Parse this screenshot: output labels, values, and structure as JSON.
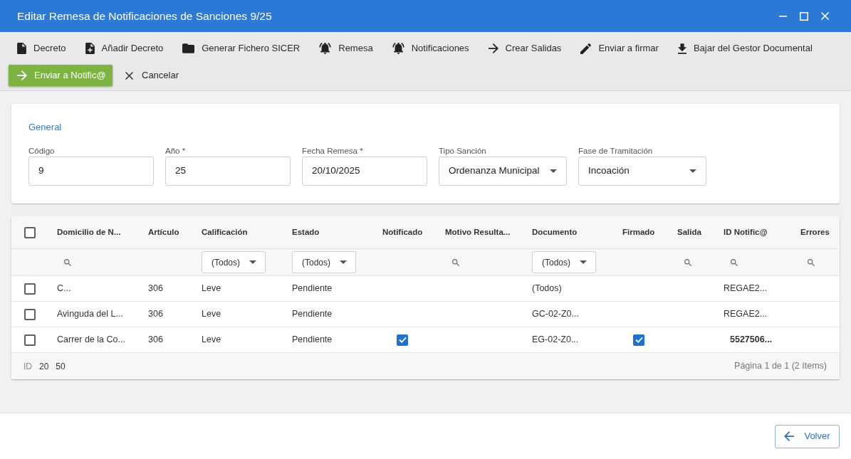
{
  "window": {
    "title": "Editar Remesa de Notificaciones de Sanciones 9/25"
  },
  "toolbar": {
    "items": [
      {
        "label": "Decreto"
      },
      {
        "label": "Añadir Decreto"
      },
      {
        "label": "Generar Fichero SICER"
      },
      {
        "label": "Remesa"
      },
      {
        "label": "Notificaciones"
      },
      {
        "label": "Crear Salidas"
      },
      {
        "label": "Enviar a firmar"
      },
      {
        "label": "Bajar del Gestor Documental"
      }
    ],
    "primary_button": {
      "label": "Enviar a Notific@"
    },
    "cancel_button": {
      "label": "Cancelar"
    }
  },
  "general": {
    "title": "General",
    "fields": [
      {
        "label": "Código",
        "value": "9",
        "kind": "text"
      },
      {
        "label": "Año *",
        "value": "25",
        "kind": "text"
      },
      {
        "label": "Fecha Remesa *",
        "value": "20/10/2025",
        "kind": "text"
      },
      {
        "label": "Tipo Sanción",
        "value": "Ordenanza Municipal",
        "kind": "select"
      },
      {
        "label": "Fase de Tramitación",
        "value": "Incoación",
        "kind": "select"
      }
    ]
  },
  "table": {
    "select_all": {
      "checked": false
    },
    "columns": [
      {
        "label": "Domicilio de N...",
        "filter": {
          "kind": "search"
        }
      },
      {
        "label": "Artículo",
        "filter": {
          "kind": "none"
        }
      },
      {
        "label": "Calificación",
        "filter": {
          "kind": "select",
          "value": "(Todos)"
        }
      },
      {
        "label": "Estado",
        "filter": {
          "kind": "select",
          "value": "(Todos)"
        }
      },
      {
        "label": "Notificado",
        "filter": {
          "kind": "none"
        }
      },
      {
        "label": "Motivo Resulta...",
        "filter": {
          "kind": "search"
        }
      },
      {
        "label": "Documento",
        "filter": {
          "kind": "select",
          "value": "(Todos)"
        }
      },
      {
        "label": "Firmado",
        "filter": {
          "kind": "none"
        }
      },
      {
        "label": "Salida",
        "filter": {
          "kind": "search"
        }
      },
      {
        "label": "ID Notific@",
        "filter": {
          "kind": "search"
        }
      },
      {
        "label": "Errores",
        "filter": {
          "kind": "search"
        }
      }
    ],
    "rows": [
      {
        "selected": false,
        "domicilio": "C...",
        "articulo": "306",
        "calificacion": "Leve",
        "estado": "Pendiente",
        "notificado": false,
        "documento": "(Todos)",
        "firmado": false,
        "id_notifica": {
          "text": "REGAE2...",
          "bold": false
        }
      },
      {
        "selected": false,
        "domicilio": "Avinguda del L...",
        "articulo": "306",
        "calificacion": "Leve",
        "estado": "Pendiente",
        "notificado": false,
        "documento": "GC-02-Z0...",
        "firmado": false,
        "id_notifica": {
          "text": "REGAE2...",
          "bold": false
        }
      },
      {
        "selected": false,
        "domicilio": "Carrer de la Co...",
        "articulo": "306",
        "calificacion": "Leve",
        "estado": "Pendiente",
        "notificado": true,
        "documento": "EG-02-Z0...",
        "firmado": true,
        "id_notifica": {
          "text": "5527506...",
          "bold": true
        }
      }
    ],
    "pager": {
      "page_sizes": [
        {
          "label": "ID",
          "selected": true
        },
        {
          "label": "20",
          "selected": false
        },
        {
          "label": "50",
          "selected": false
        }
      ],
      "page_info": "Página 1 de 1 (2 ítems)"
    }
  },
  "footer": {
    "back_button": {
      "label": "Volver"
    }
  }
}
